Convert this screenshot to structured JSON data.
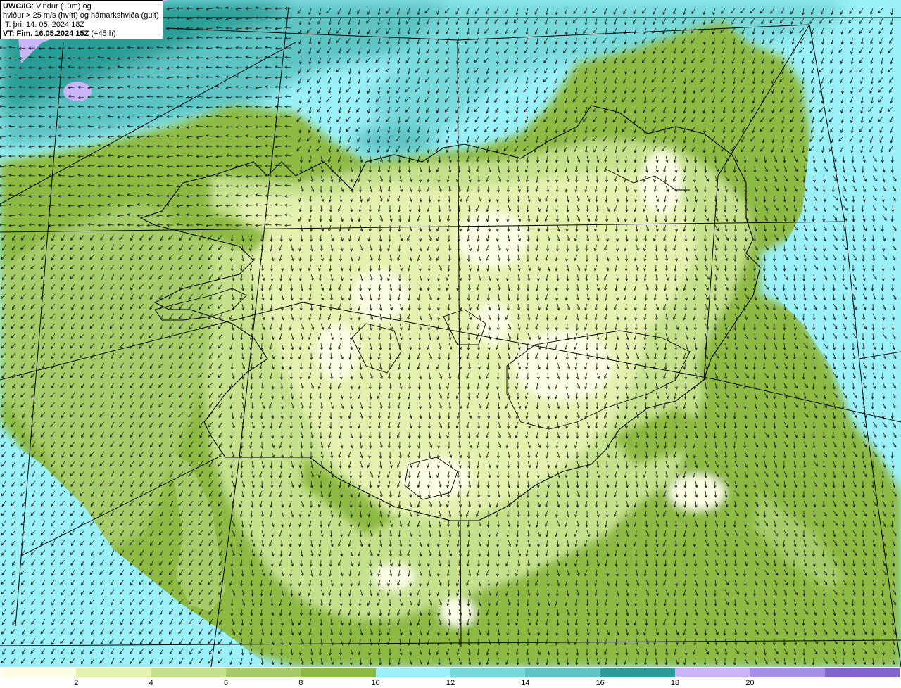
{
  "header": {
    "model": "UWC/IG",
    "title_rest": ": Vindur (10m) og",
    "line2": "hviður > 25 m/s (hvítt) og hámarkshviða (gult)",
    "line3": "IT: þri. 14. 05. 2024 18Z",
    "line4_label": "VT: Fim. 16.05.2024 15Z",
    "line4_rest": " (+45 h)"
  },
  "legend": {
    "colors": [
      "#fcfee4",
      "#e3f1ae",
      "#c5e18c",
      "#a5cc68",
      "#8dba43",
      "#9af0f7",
      "#78d9db",
      "#5dc3c3",
      "#2b9d96",
      "#c9b4f8",
      "#a58ee6",
      "#7f64cc"
    ],
    "labels": [
      "2",
      "4",
      "6",
      "8",
      "10",
      "12",
      "14",
      "16",
      "18",
      "20"
    ]
  }
}
